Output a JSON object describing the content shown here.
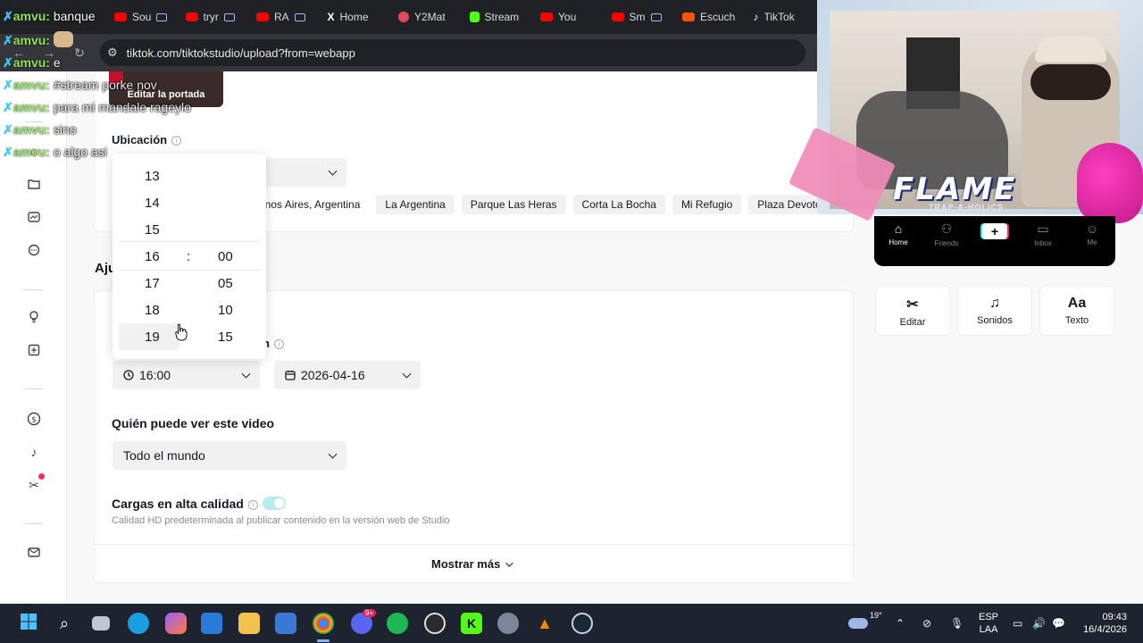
{
  "browser": {
    "tabs": [
      {
        "label": "Sou",
        "icon": "youtube-icon",
        "color": "#ff0000"
      },
      {
        "label": "tryr",
        "icon": "youtube-icon",
        "color": "#ff0000"
      },
      {
        "label": "RA",
        "icon": "youtube-icon",
        "color": "#ff0000"
      },
      {
        "label": "Home",
        "icon": "x-icon",
        "color": "#ffffff"
      },
      {
        "label": "Y2Mat",
        "icon": "y2mate-icon",
        "color": "#e04a5a"
      },
      {
        "label": "Stream",
        "icon": "kick-icon",
        "color": "#53fc18"
      },
      {
        "label": "You",
        "icon": "youtube-icon",
        "color": "#ff0000"
      },
      {
        "label": "Sm",
        "icon": "youtube-icon",
        "color": "#ff0000"
      },
      {
        "label": "Escuch",
        "icon": "soundcloud-icon",
        "color": "#ff5500"
      },
      {
        "label": "TikTok",
        "icon": "tiktok-icon",
        "color": "#ffffff"
      }
    ],
    "url": "tiktok.com/tiktokstudio/upload?from=webapp"
  },
  "chat": {
    "messages": [
      {
        "user": "amvu:",
        "text": "banque"
      },
      {
        "user": "amvu:",
        "text": ""
      },
      {
        "user": "amvu:",
        "text": "e"
      },
      {
        "user": "amvu:",
        "text": "#stream porke nov"
      },
      {
        "user": "amvu:",
        "text": "para mi mandale rageylo"
      },
      {
        "user": "amvu:",
        "text": "sino"
      },
      {
        "user": "amvu:",
        "text": "o algo asi"
      }
    ]
  },
  "studio": {
    "cover_label": "Editar la portada",
    "location_title": "Ubicación",
    "location_chips": [
      "enos Aires, Argentina",
      "La Argentina",
      "Parque Las Heras",
      "Corta La Bocha",
      "Mi Refugio",
      "Plaza Devoto"
    ],
    "settings_title_partial": "Aju",
    "schedule_label_partial": "ón",
    "time_value": "16:00",
    "date_value": "2026-04-16",
    "privacy_label": "Quién puede ver este video",
    "privacy_value": "Todo el mundo",
    "hq_label": "Cargas en alta calidad",
    "hq_hint": "Calidad HD predeterminada al publicar contenido en la versión web de Studio",
    "hq_enabled": true,
    "show_more": "Mostrar más"
  },
  "time_picker": {
    "hours": [
      "13",
      "14",
      "15",
      "16",
      "17",
      "18",
      "19"
    ],
    "minutes": [
      "00",
      "05",
      "10",
      "15"
    ],
    "colon": ":",
    "selected_hour": "16",
    "selected_minute": "00"
  },
  "preview": {
    "nav": [
      {
        "label": "Home",
        "icon": "home-icon"
      },
      {
        "label": "Friends",
        "icon": "friends-icon"
      },
      {
        "label": "Inbox",
        "icon": "inbox-icon"
      },
      {
        "label": "Me",
        "icon": "profile-icon"
      }
    ],
    "tools": [
      {
        "label": "Editar",
        "icon": "scissors-icon"
      },
      {
        "label": "Sonidos",
        "icon": "music-note-icon"
      },
      {
        "label": "Texto",
        "icon": "text-icon",
        "glyph": "Aa"
      }
    ]
  },
  "overlay": {
    "logo_text": "FLAME",
    "logo_sub": "TRAP-A-HOLICS"
  },
  "taskbar": {
    "weather": "19°",
    "lang_top": "ESP",
    "lang_bottom": "LAA",
    "time": "09:43",
    "date": "16/4/2026",
    "discord_badge": "9+"
  }
}
